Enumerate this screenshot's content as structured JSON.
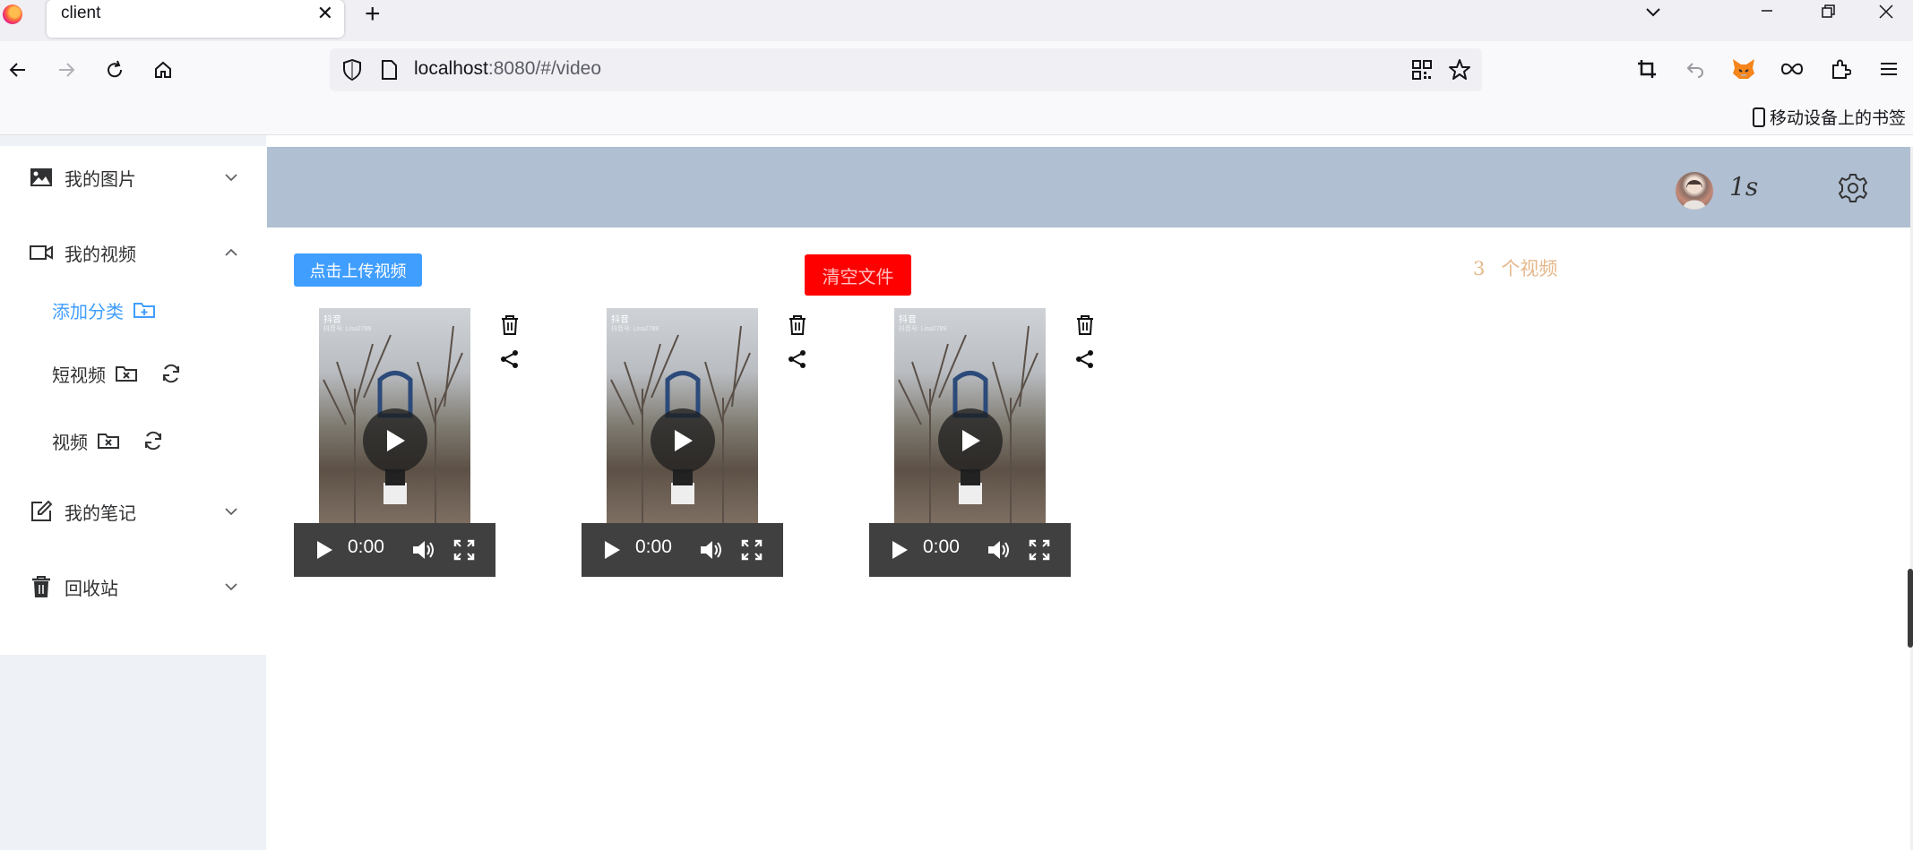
{
  "browser": {
    "tab_title": "client",
    "tab_close": "✕",
    "new_tab": "+",
    "url_host": "localhost",
    "url_rest": ":8080/#/video",
    "bookmark_mobile": "移动设备上的书签"
  },
  "sidebar": {
    "items": [
      {
        "label": "我的图片",
        "icon": "image-icon",
        "expanded": false
      },
      {
        "label": "我的视频",
        "icon": "video-camera-icon",
        "expanded": true
      },
      {
        "label": "我的笔记",
        "icon": "edit-icon",
        "expanded": false
      },
      {
        "label": "回收站",
        "icon": "trash-icon",
        "expanded": false
      }
    ],
    "video_submenu": [
      {
        "label": "添加分类",
        "icon": "folder-add-icon",
        "active": true
      },
      {
        "label": "短视频",
        "icon": "folder-delete-icon"
      },
      {
        "label": "视频",
        "icon": "folder-delete-icon"
      }
    ]
  },
  "header": {
    "username": "1s"
  },
  "main": {
    "upload_button": "点击上传视频",
    "clear_button": "清空文件",
    "video_count": "3",
    "video_count_label": "个视频",
    "videos": [
      {
        "time": "0:00",
        "watermark": "抖音",
        "watermark_sub": "抖音号: Lisa2789"
      },
      {
        "time": "0:00",
        "watermark": "抖音",
        "watermark_sub": "抖音号: Lisa2789"
      },
      {
        "time": "0:00",
        "watermark": "抖音",
        "watermark_sub": "抖音号: Lisa2789"
      }
    ]
  },
  "colors": {
    "header_bg": "#b0bfd2",
    "primary": "#409eff",
    "danger": "#ff0000",
    "count_text": "#e6b88c"
  }
}
